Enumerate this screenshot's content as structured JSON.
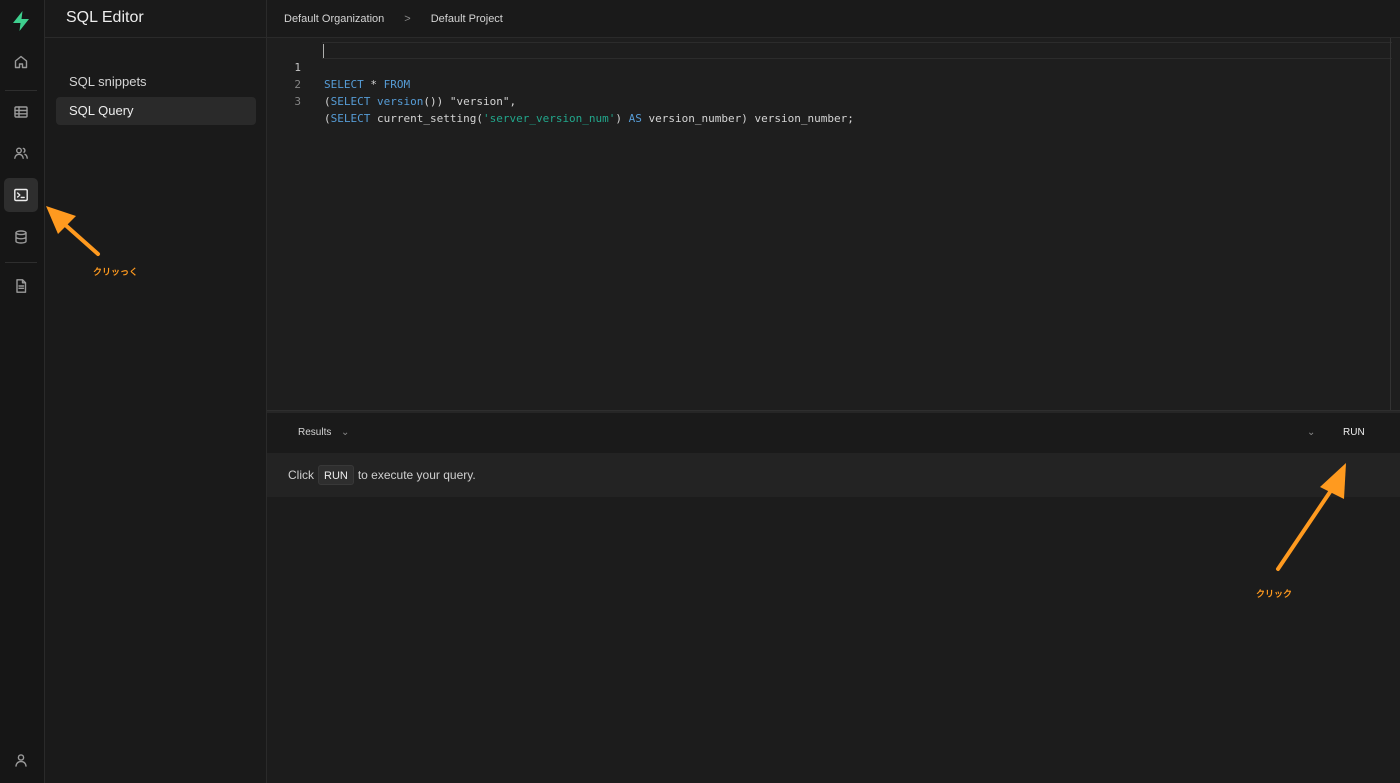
{
  "app": {
    "brand_color": "#3ecf8e",
    "accent_annotation": "#ff9a1f"
  },
  "rail": {
    "icons": [
      "home-icon",
      "table-icon",
      "users-icon",
      "terminal-icon",
      "database-icon",
      "document-icon",
      "user-icon"
    ],
    "active": "terminal-icon"
  },
  "panel": {
    "title": "SQL Editor",
    "items": [
      {
        "label": "SQL snippets"
      },
      {
        "label": "SQL Query"
      }
    ]
  },
  "breadcrumb": {
    "organization": "Default Organization",
    "separator": ">",
    "project": "Default Project"
  },
  "editor": {
    "lines": [
      {
        "num": "1",
        "tokens": [
          {
            "t": "SELECT",
            "c": "kw"
          },
          {
            "t": " * ",
            "c": ""
          },
          {
            "t": "FROM",
            "c": "kw"
          }
        ]
      },
      {
        "num": "2",
        "tokens": [
          {
            "t": "(",
            "c": ""
          },
          {
            "t": "SELECT",
            "c": "kw"
          },
          {
            "t": " ",
            "c": ""
          },
          {
            "t": "version",
            "c": "fn"
          },
          {
            "t": "()) \"version\",",
            "c": ""
          }
        ]
      },
      {
        "num": "3",
        "tokens": [
          {
            "t": "(",
            "c": ""
          },
          {
            "t": "SELECT",
            "c": "kw"
          },
          {
            "t": " current_setting(",
            "c": ""
          },
          {
            "t": "'server_version_num'",
            "c": "str"
          },
          {
            "t": ") ",
            "c": ""
          },
          {
            "t": "AS",
            "c": "kw"
          },
          {
            "t": " version_number) version_number;",
            "c": ""
          }
        ]
      }
    ]
  },
  "results": {
    "tab_label": "Results",
    "tab_chevron": "⌄",
    "run_chevron": "⌄",
    "run_label": "RUN",
    "hint_before": "Click",
    "hint_key": "RUN",
    "hint_after": "to execute your query."
  },
  "annotations": {
    "left_note": "クリッっく",
    "right_note": "クリック"
  }
}
